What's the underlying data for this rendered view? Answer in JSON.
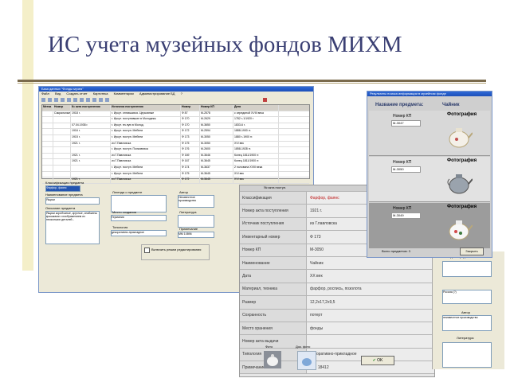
{
  "slide": {
    "title": "ИС учета музейных фондов МИХМ"
  },
  "main_window": {
    "title": "База данных \"Фонды музея\"",
    "menu": [
      "Файл",
      "Вид",
      "Создать отчет",
      "Картотека",
      "Комментарии",
      "Администрирование БД",
      "?"
    ],
    "table_headers": [
      "Метка",
      "Номер",
      "№ акта поступления",
      "Источник поступления",
      "Номер",
      "Номер КП",
      "Дата"
    ],
    "table_rows": [
      [
        "",
        "Сакральные",
        "1918 г.",
        "г. Иркут. отнявшихся. Церковные",
        "Ф 87",
        "М-2578",
        "с серединой XVIII века"
      ],
      [
        "",
        "",
        "",
        "г. Иркут. поступившие в Молодежь",
        "Ф 170",
        "М-2629",
        "1782 г-1/1920 г"
      ],
      [
        "",
        "",
        "07.04.1938 г.",
        "г. Иркут. пп-ную в Молод.",
        "Ф 170",
        "М-3650",
        "1833-6 г."
      ],
      [
        "",
        "",
        "1916 г.",
        "г. Иркут. поступ. Мебели",
        "Ф 172",
        "М-2594",
        "1888-1900 гг."
      ],
      [
        "",
        "",
        "1915 г.",
        "г. Иркут. поступ. Мебели",
        "Ф 173",
        "М-3050",
        "1880 г-1900 гг."
      ],
      [
        "",
        "",
        "1921 г.",
        "из Г.Павловска",
        "Ф 175",
        "М-3050",
        "XVI век"
      ],
      [
        "",
        "",
        "",
        "г. Иркут. поступ. Полковника",
        "Ф 176",
        "М-2600",
        "1858-1928 гг."
      ],
      [
        "",
        "",
        "1921 г.",
        "из Г.Павловска",
        "Ф 169",
        "М-3646",
        "Конец 1811/1900 гг."
      ],
      [
        "",
        "",
        "1921 г.",
        "из Г.Павловска",
        "Ф 167",
        "М-3645",
        "Конец 1811/1900 гг."
      ],
      [
        "",
        "",
        "",
        "г. Иркут. поступ. Мебели",
        "Ф 174",
        "М-3637",
        "2 половина XVIII века"
      ],
      [
        "",
        "",
        "",
        "г. Иркут. поступ. Мебели",
        "Ф 175",
        "М-3645",
        "XVI век"
      ],
      [
        "",
        "",
        "1921 г.",
        "из Г.Павловска",
        "Ф 172",
        "М-3645",
        "XVI век"
      ]
    ],
    "labels": {
      "classification": "Классификация предмета",
      "object_name": "Наименование предмета",
      "description": "Описание предмета",
      "legend": "Легенда о предмете",
      "author": "Автор",
      "literature": "Литература",
      "place_created": "Место создания",
      "typology": "Типология",
      "note": "Примечание",
      "edit_mode": "Включить режим редактирования"
    },
    "values": {
      "classification": "Фарфор, фаянс",
      "object_name": "Ящики",
      "description": "Ящики коробчатые, круглые, снабжены крышками с изображением из нескольких деталей...",
      "author": "Неизвестное производство",
      "place_created": "Германия",
      "typology": "декоративно-прикладное",
      "note": "ММ 10896"
    }
  },
  "detail_card": {
    "header": "№ акта поступ.",
    "rows": [
      {
        "key": "Классификация",
        "value": "Фарфор, фаянс"
      },
      {
        "key": "Номер акта поступления",
        "value": "1921 г."
      },
      {
        "key": "Источник поступления",
        "value": "из Г.павловска"
      },
      {
        "key": "Инвентарный номер",
        "value": "Ф 173"
      },
      {
        "key": "Номер КП",
        "value": "М-3050"
      },
      {
        "key": "Наименование",
        "value": "Чайник"
      },
      {
        "key": "Дата",
        "value": "XX век"
      },
      {
        "key": "Материал, техника",
        "value": "фарфор, роспись, позолота"
      },
      {
        "key": "Размер",
        "value": "12,2х17,2х9,5"
      },
      {
        "key": "Сохранность",
        "value": "потерт"
      },
      {
        "key": "Место хранения",
        "value": "фонды"
      },
      {
        "key": "Номер акта выдачи",
        "value": ""
      },
      {
        "key": "Типология",
        "value": "декоративно-прикладное"
      },
      {
        "key": "Примечание",
        "value": "ММ 18412"
      }
    ],
    "photo_label": "Фото",
    "doc_photo_label": "Док. фото",
    "ok_label": "OK"
  },
  "search_window": {
    "title": "Результаты поиска информации в музейном фонде",
    "name_label": "Название предмета:",
    "name_value": "Чайник",
    "items": [
      {
        "kp_label": "Номер КП",
        "kp_value": "М-3047",
        "photo_label": "Фотография"
      },
      {
        "kp_label": "Номер КП",
        "kp_value": "М-3050",
        "photo_label": "Фотография"
      },
      {
        "kp_label": "Номер КП",
        "kp_value": "М-3049",
        "photo_label": "Фотография"
      }
    ],
    "footer_label": "Всего предметов: 3",
    "close_label": "Закрыть"
  },
  "right_panel": {
    "legend_label": "Легенда о предмете",
    "country_value": "Россия (?)",
    "author_label": "Автор",
    "author_value": "неизвестное производство",
    "literature_label": "Литература"
  }
}
